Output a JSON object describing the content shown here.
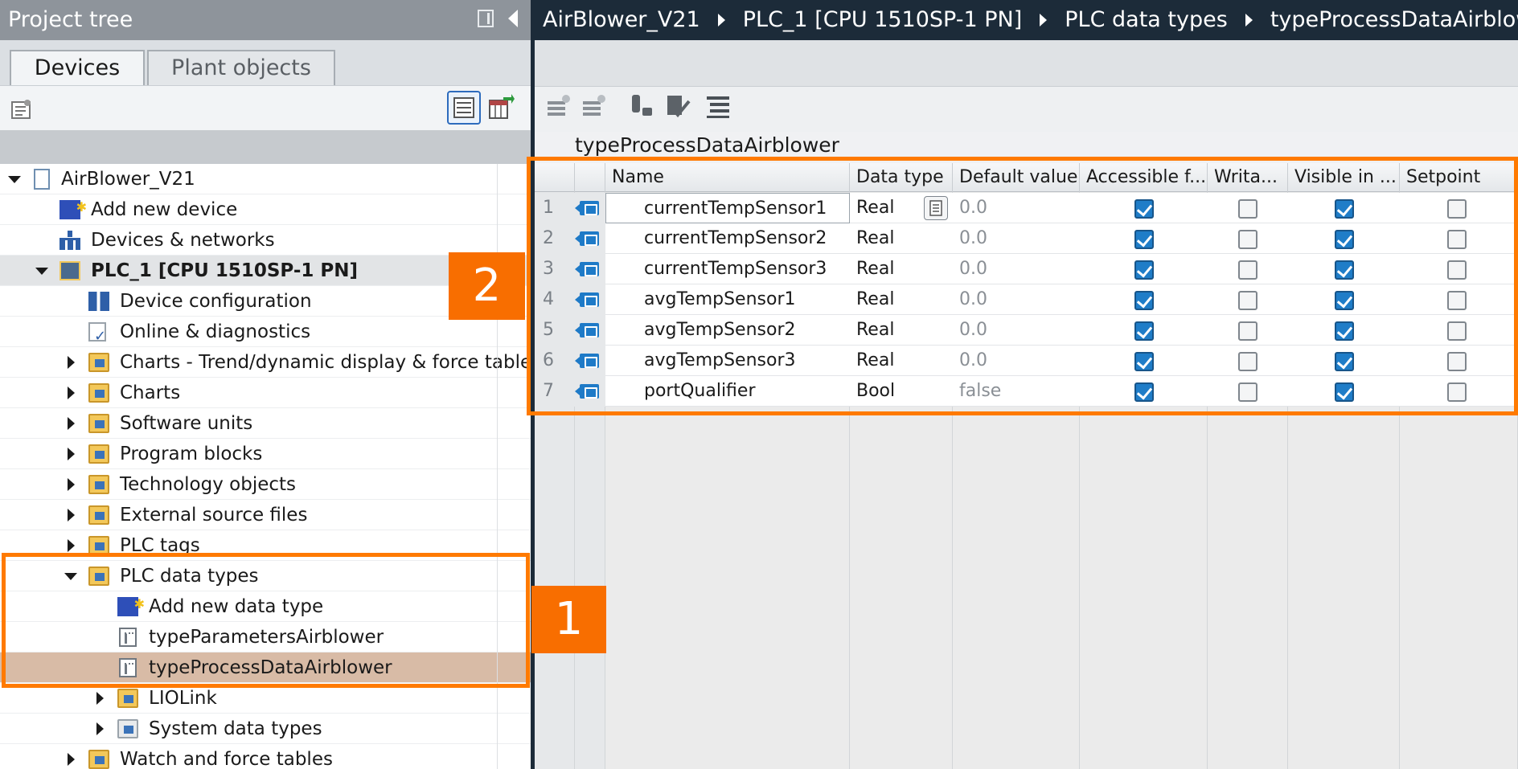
{
  "project_tree": {
    "title": "Project tree",
    "tabs": [
      {
        "label": "Devices",
        "active": true
      },
      {
        "label": "Plant objects",
        "active": false
      }
    ],
    "items": [
      {
        "label": "AirBlower_V21",
        "icon": "project-doc-icon",
        "expanded": true
      },
      {
        "label": "Add new device",
        "icon": "add-device-icon"
      },
      {
        "label": "Devices & networks",
        "icon": "network-icon"
      },
      {
        "label": "PLC_1 [CPU 1510SP-1 PN]",
        "icon": "plc-icon",
        "expanded": true
      },
      {
        "label": "Device configuration",
        "icon": "device-config-icon"
      },
      {
        "label": "Online & diagnostics",
        "icon": "diagnostics-icon"
      },
      {
        "label": "Charts - Trend/dynamic display & force table",
        "icon": "folder-icon"
      },
      {
        "label": "Charts",
        "icon": "folder-icon"
      },
      {
        "label": "Software units",
        "icon": "folder-icon"
      },
      {
        "label": "Program blocks",
        "icon": "folder-icon"
      },
      {
        "label": "Technology objects",
        "icon": "folder-icon"
      },
      {
        "label": "External source files",
        "icon": "folder-icon"
      },
      {
        "label": "PLC tags",
        "icon": "folder-icon"
      },
      {
        "label": "PLC data types",
        "icon": "folder-icon",
        "expanded": true
      },
      {
        "label": "Add new data type",
        "icon": "add-type-icon"
      },
      {
        "label": "typeParametersAirblower",
        "icon": "data-type-icon"
      },
      {
        "label": "typeProcessDataAirblower",
        "icon": "data-type-icon",
        "selected": true
      },
      {
        "label": "LIOLink",
        "icon": "folder-icon"
      },
      {
        "label": "System data types",
        "icon": "folder-icon"
      },
      {
        "label": "Watch and force tables",
        "icon": "folder-icon"
      }
    ]
  },
  "breadcrumb": [
    "AirBlower_V21",
    "PLC_1 [CPU 1510SP-1 PN]",
    "PLC data types",
    "typeProcessDataAirblower"
  ],
  "editor": {
    "title": "typeProcessDataAirblower",
    "columns": [
      "Name",
      "Data type",
      "Default value",
      "Accessible f...",
      "Writa...",
      "Visible in ...",
      "Setpoint"
    ],
    "rows": [
      {
        "num": "1",
        "name": "currentTempSensor1",
        "type": "Real",
        "default": "0.0",
        "accessible": true,
        "writable": false,
        "visible": true,
        "setpoint": false
      },
      {
        "num": "2",
        "name": "currentTempSensor2",
        "type": "Real",
        "default": "0.0",
        "accessible": true,
        "writable": false,
        "visible": true,
        "setpoint": false
      },
      {
        "num": "3",
        "name": "currentTempSensor3",
        "type": "Real",
        "default": "0.0",
        "accessible": true,
        "writable": false,
        "visible": true,
        "setpoint": false
      },
      {
        "num": "4",
        "name": "avgTempSensor1",
        "type": "Real",
        "default": "0.0",
        "accessible": true,
        "writable": false,
        "visible": true,
        "setpoint": false
      },
      {
        "num": "5",
        "name": "avgTempSensor2",
        "type": "Real",
        "default": "0.0",
        "accessible": true,
        "writable": false,
        "visible": true,
        "setpoint": false
      },
      {
        "num": "6",
        "name": "avgTempSensor3",
        "type": "Real",
        "default": "0.0",
        "accessible": true,
        "writable": false,
        "visible": true,
        "setpoint": false
      },
      {
        "num": "7",
        "name": "portQualifier",
        "type": "Bool",
        "default": "false",
        "accessible": true,
        "writable": false,
        "visible": true,
        "setpoint": false
      }
    ]
  },
  "callouts": {
    "one": "1",
    "two": "2"
  },
  "colors": {
    "highlight": "#ff7a00",
    "callout": "#f86e00",
    "selected_row": "#d8bba6",
    "checkbox_on": "#1f7dc8",
    "dark_header": "#1c2b39"
  }
}
